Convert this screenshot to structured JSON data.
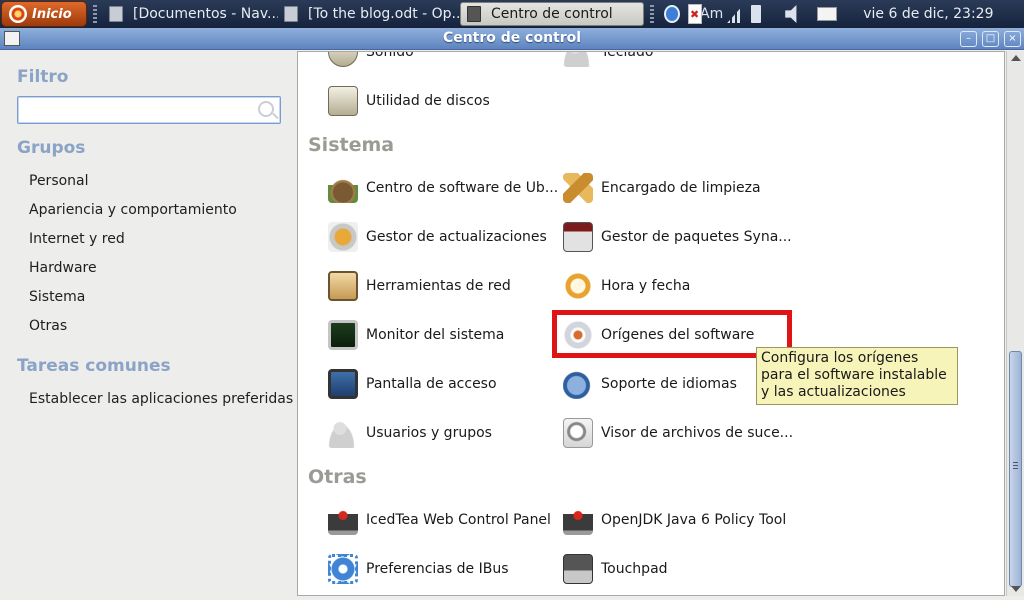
{
  "panel": {
    "start_label": "Inicio",
    "tasks": [
      {
        "label": "[Documentos - Nav..."
      },
      {
        "label": "[To the blog.odt - Op..."
      },
      {
        "label": "Centro de control"
      }
    ],
    "tray_text": "Am",
    "clock": "vie  6 de dic, 23:29"
  },
  "window": {
    "title": "Centro de control",
    "controls": {
      "minimize": "–",
      "maximize": "□",
      "close": "×"
    }
  },
  "sidebar": {
    "filter_heading": "Filtro",
    "filter_value": "",
    "groups_heading": "Grupos",
    "groups": [
      "Personal",
      "Apariencia y comportamiento",
      "Internet y red",
      "Hardware",
      "Sistema",
      "Otras"
    ],
    "tasks_heading": "Tareas comunes",
    "tasks": [
      "Establecer las aplicaciones preferidas"
    ]
  },
  "content": {
    "partial_items": [
      "Sonido",
      "Teclado"
    ],
    "items_top": [
      "Utilidad de discos"
    ],
    "sections": [
      {
        "heading": "Sistema",
        "items": [
          {
            "label": "Centro de software de Ub...",
            "icon": "software-center-icon"
          },
          {
            "label": "Encargado de limpieza",
            "icon": "janitor-icon"
          },
          {
            "label": "Gestor de actualizaciones",
            "icon": "update-manager-icon"
          },
          {
            "label": "Gestor de paquetes Syna...",
            "icon": "synaptic-icon"
          },
          {
            "label": "Herramientas de red",
            "icon": "network-tools-icon"
          },
          {
            "label": "Hora y fecha",
            "icon": "clock-icon"
          },
          {
            "label": "Monitor del sistema",
            "icon": "system-monitor-icon"
          },
          {
            "label": "Orígenes del software",
            "icon": "software-sources-icon"
          },
          {
            "label": "Pantalla de acceso",
            "icon": "login-screen-icon"
          },
          {
            "label": "Soporte de idiomas",
            "icon": "language-support-icon"
          },
          {
            "label": "Usuarios y grupos",
            "icon": "users-groups-icon"
          },
          {
            "label": "Visor de archivos de suce...",
            "icon": "log-viewer-icon"
          }
        ]
      },
      {
        "heading": "Otras",
        "items": [
          {
            "label": "IcedTea Web Control Panel",
            "icon": "java-icon"
          },
          {
            "label": "OpenJDK Java 6 Policy Tool",
            "icon": "java-icon"
          },
          {
            "label": "Preferencias de IBus",
            "icon": "gear-icon"
          },
          {
            "label": "Touchpad",
            "icon": "touchpad-icon"
          }
        ]
      }
    ],
    "tooltip": "Configura los orígenes para el software instalable y las actualizaciones"
  },
  "colors": {
    "highlight": "#e01414",
    "tooltip_bg": "#f7f4b9",
    "heading_blue": "#8aa3c6",
    "titlebar": "#5e83bf"
  }
}
